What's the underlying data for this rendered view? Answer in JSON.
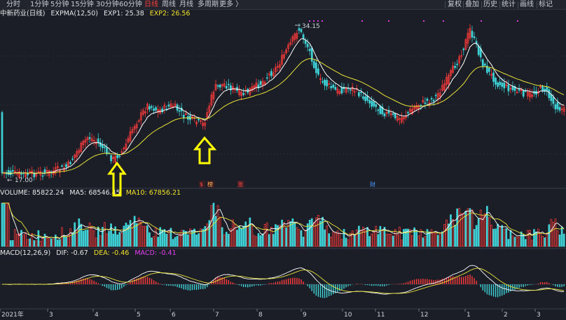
{
  "toolbar": {
    "left_items": [
      "分时",
      "1分钟",
      "5分钟",
      "15分钟",
      "30分钟",
      "60分钟",
      "日线",
      "周线",
      "月线",
      "多周期",
      "更多 〉"
    ],
    "active_index": 6,
    "right_items": [
      "复权",
      "叠加",
      "历史",
      "统计",
      "画线",
      "标记"
    ]
  },
  "price_panel": {
    "stock_name": "中新药业(日线)",
    "indicator": "EXPMA(12,50)",
    "exp1_label": "EXP1: 25.38",
    "exp2_label": "EXP2: 26.56",
    "high_label": "34.15",
    "low_label": "17.00",
    "event_marks": [
      "$",
      "榜",
      "涨",
      "财"
    ]
  },
  "volume_panel": {
    "volume_label": "VOLUME: 85822.24",
    "ma5_label": "MA5: 68546.45",
    "ma10_label": "MA10: 67856.21"
  },
  "macd_panel": {
    "name": "MACD(12,26,9)",
    "dif_label": "DIF: -0.67",
    "dea_label": "DEA: -0.46",
    "macd_label": "MACD: -0.41"
  },
  "x_axis": [
    "2021年",
    "3",
    "4",
    "5",
    "6",
    "7",
    "8",
    "9",
    "10",
    "11",
    "12",
    "1",
    "2",
    "3"
  ],
  "colors": {
    "up": "#ff3b3b",
    "down": "#3fd2d6",
    "exp1": "#ffffff",
    "exp2": "#e8e23a",
    "arrow": "#ffff00",
    "background": "#1b1e26"
  },
  "annotations": [
    "yellow-up-arrow",
    "yellow-up-arrow"
  ]
}
